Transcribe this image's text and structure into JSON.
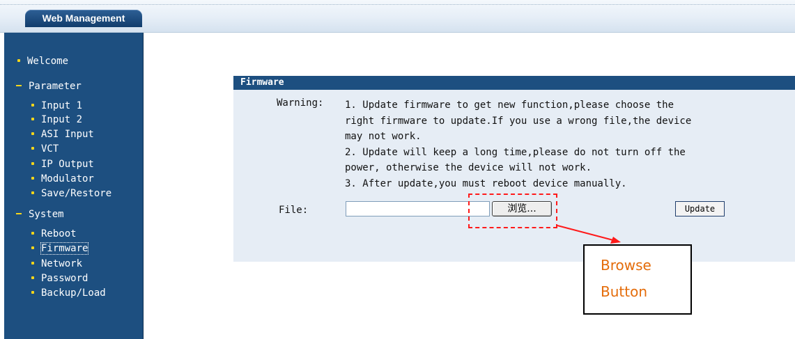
{
  "header": {
    "tab_label": "Web Management"
  },
  "sidebar": {
    "welcome": "Welcome",
    "parameter": {
      "label": "Parameter",
      "items": [
        "Input 1",
        "Input 2",
        "ASI Input",
        "VCT",
        "IP Output",
        "Modulator",
        "Save/Restore"
      ]
    },
    "system": {
      "label": "System",
      "items": [
        "Reboot",
        "Firmware",
        "Network",
        "Password",
        "Backup/Load"
      ],
      "active": "Firmware"
    }
  },
  "panel": {
    "title": "Firmware",
    "warning_label": "Warning:",
    "warning_lines": [
      "1. Update firmware to get new function,please choose the",
      "right firmware to update.If you use a wrong file,the device",
      "may not work.",
      "2. Update will keep a long time,please do not turn off the",
      "power, otherwise the device will not work.",
      "3. After update,you must reboot device manually."
    ],
    "file_label": "File:",
    "file_value": "",
    "browse_label": "浏览...",
    "update_label": "Update"
  },
  "annotation": {
    "callout_line1": "Browse",
    "callout_line2": "Button"
  },
  "colors": {
    "sidebar_bg": "#1d4f80",
    "panel_bg": "#e6edf5",
    "bullet": "#f6d61a",
    "annotation_red": "#ff1a1a",
    "callout_text": "#e46c0a"
  }
}
